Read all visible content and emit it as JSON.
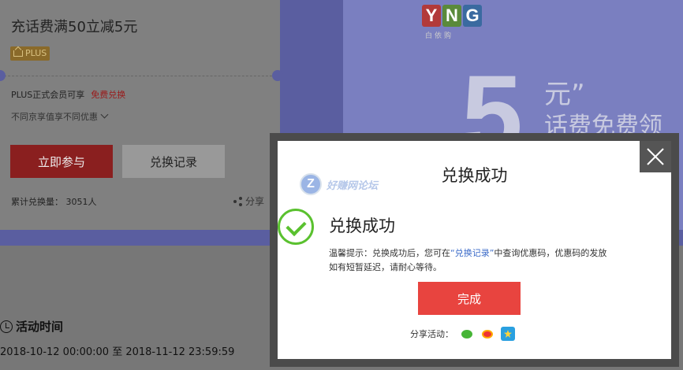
{
  "coupon": {
    "title": "充话费满50立减5元",
    "plus_badge": "PLUS",
    "member_note": "PLUS正式会员可享",
    "member_action": "免费兑换",
    "diff_note": "不同京享值享不同优惠",
    "join_label": "立即参与",
    "record_label": "兑换记录",
    "redeem_count": "累计兑换量： 3051人",
    "share_label": "分享"
  },
  "banner": {
    "brand_letters": [
      "Y",
      "N",
      "G"
    ],
    "brand_sub": "白依购",
    "big_digit": "5",
    "yuan_text": "元”",
    "tagline": "话费免费领"
  },
  "activity": {
    "title": "活动时间",
    "range": "2018-10-12 00:00:00 至 2018-11-12 23:59:59"
  },
  "modal": {
    "title": "兑换成功",
    "watermark": "好赚网论坛",
    "watermark_logo": "Z",
    "success_heading": "兑换成功",
    "tip_before": "温馨提示：兑换成功后，您可在",
    "tip_link": "“兑换记录”",
    "tip_after": "中查询优惠码，优惠码的发放如有短暂延迟，请耐心等待。",
    "done_label": "完成",
    "share_label": "分享活动："
  },
  "colors": {
    "accent_red": "#e8443f",
    "success_green": "#5ac12f",
    "link_blue": "#3a6ac8",
    "banner_purple": "#7a7fc0"
  }
}
